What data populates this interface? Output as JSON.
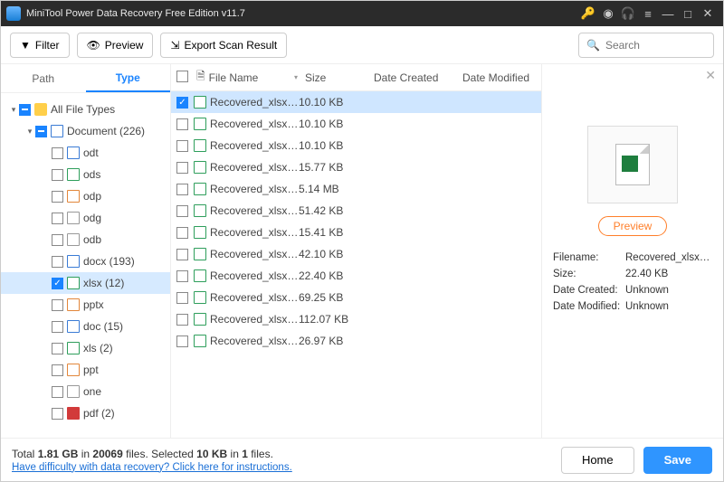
{
  "titlebar": {
    "title": "MiniTool Power Data Recovery Free Edition v11.7"
  },
  "toolbar": {
    "filter": "Filter",
    "preview": "Preview",
    "export": "Export Scan Result",
    "search_placeholder": "Search"
  },
  "tabs": {
    "path": "Path",
    "type": "Type"
  },
  "tree": [
    {
      "indent": 0,
      "caret": "▾",
      "check": "tri",
      "icon": "folder",
      "label": "All File Types",
      "selected": false
    },
    {
      "indent": 1,
      "caret": "▾",
      "check": "tri",
      "icon": "doc blue",
      "label": "Document (226)",
      "selected": false
    },
    {
      "indent": 2,
      "caret": "",
      "check": "off",
      "icon": "doc blue",
      "label": "odt",
      "selected": false
    },
    {
      "indent": 2,
      "caret": "",
      "check": "off",
      "icon": "doc green",
      "label": "ods",
      "selected": false
    },
    {
      "indent": 2,
      "caret": "",
      "check": "off",
      "icon": "doc orange",
      "label": "odp",
      "selected": false
    },
    {
      "indent": 2,
      "caret": "",
      "check": "off",
      "icon": "doc",
      "label": "odg",
      "selected": false
    },
    {
      "indent": 2,
      "caret": "",
      "check": "off",
      "icon": "doc",
      "label": "odb",
      "selected": false
    },
    {
      "indent": 2,
      "caret": "",
      "check": "off",
      "icon": "doc blue",
      "label": "docx (193)",
      "selected": false
    },
    {
      "indent": 2,
      "caret": "",
      "check": "on",
      "icon": "doc green",
      "label": "xlsx (12)",
      "selected": true
    },
    {
      "indent": 2,
      "caret": "",
      "check": "off",
      "icon": "doc orange",
      "label": "pptx",
      "selected": false
    },
    {
      "indent": 2,
      "caret": "",
      "check": "off",
      "icon": "doc blue",
      "label": "doc (15)",
      "selected": false
    },
    {
      "indent": 2,
      "caret": "",
      "check": "off",
      "icon": "doc green",
      "label": "xls (2)",
      "selected": false
    },
    {
      "indent": 2,
      "caret": "",
      "check": "off",
      "icon": "doc orange",
      "label": "ppt",
      "selected": false
    },
    {
      "indent": 2,
      "caret": "",
      "check": "off",
      "icon": "doc",
      "label": "one",
      "selected": false
    },
    {
      "indent": 2,
      "caret": "",
      "check": "off",
      "icon": "doc red",
      "label": "pdf (2)",
      "selected": false
    }
  ],
  "columns": {
    "name": "File Name",
    "size": "Size",
    "dc": "Date Created",
    "dm": "Date Modified"
  },
  "files": [
    {
      "check": "on",
      "name": "Recovered_xlsx_fi...",
      "size": "10.10 KB",
      "selected": true
    },
    {
      "check": "off",
      "name": "Recovered_xlsx_fi...",
      "size": "10.10 KB",
      "selected": false
    },
    {
      "check": "off",
      "name": "Recovered_xlsx_fi...",
      "size": "10.10 KB",
      "selected": false
    },
    {
      "check": "off",
      "name": "Recovered_xlsx_fi...",
      "size": "15.77 KB",
      "selected": false
    },
    {
      "check": "off",
      "name": "Recovered_xlsx_fi...",
      "size": "5.14 MB",
      "selected": false
    },
    {
      "check": "off",
      "name": "Recovered_xlsx_fi...",
      "size": "51.42 KB",
      "selected": false
    },
    {
      "check": "off",
      "name": "Recovered_xlsx_fi...",
      "size": "15.41 KB",
      "selected": false
    },
    {
      "check": "off",
      "name": "Recovered_xlsx_fi...",
      "size": "42.10 KB",
      "selected": false
    },
    {
      "check": "off",
      "name": "Recovered_xlsx_fi...",
      "size": "22.40 KB",
      "selected": false
    },
    {
      "check": "off",
      "name": "Recovered_xlsx_fi...",
      "size": "69.25 KB",
      "selected": false
    },
    {
      "check": "off",
      "name": "Recovered_xlsx_fi...",
      "size": "112.07 KB",
      "selected": false
    },
    {
      "check": "off",
      "name": "Recovered_xlsx_fi...",
      "size": "26.97 KB",
      "selected": false
    }
  ],
  "preview": {
    "button": "Preview",
    "labels": {
      "filename": "Filename:",
      "size": "Size:",
      "dc": "Date Created:",
      "dm": "Date Modified:"
    },
    "values": {
      "filename": "Recovered_xlsx_file(",
      "size": "22.40 KB",
      "dc": "Unknown",
      "dm": "Unknown"
    }
  },
  "footer": {
    "total_prefix": "Total ",
    "total_size": "1.81 GB",
    "total_mid": " in ",
    "total_files": "20069",
    "total_suffix": " files.  ",
    "sel_prefix": "Selected ",
    "sel_size": "10 KB",
    "sel_mid": " in ",
    "sel_count": "1",
    "sel_suffix": " files.",
    "help_link": "Have difficulty with data recovery? Click here for instructions.",
    "home": "Home",
    "save": "Save"
  }
}
